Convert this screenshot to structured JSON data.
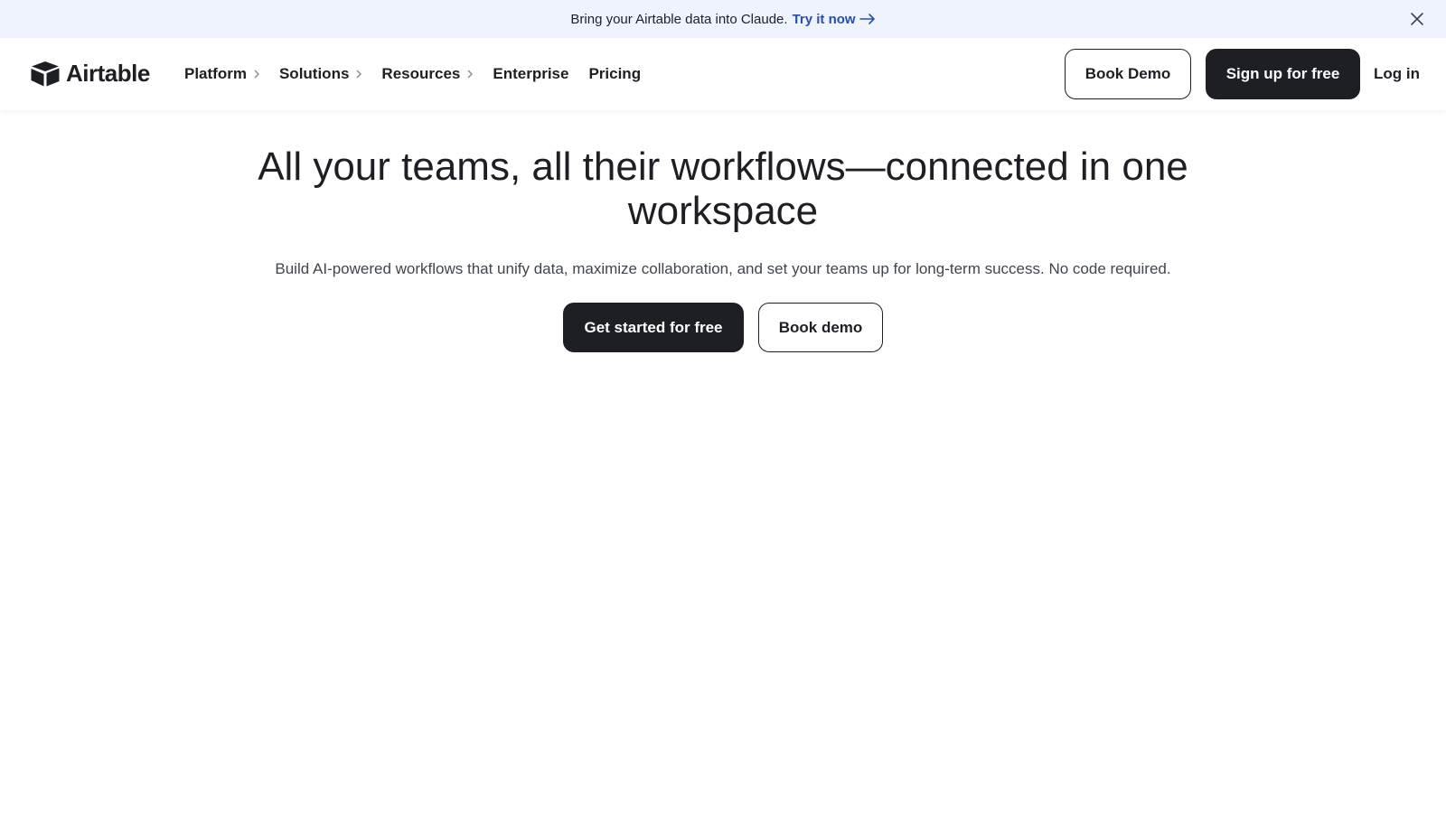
{
  "announcement": {
    "message": "Bring your Airtable data into Claude.",
    "cta": "Try it now",
    "icons": {
      "arrow": "arrow-right-icon",
      "close": "close-icon"
    },
    "background": "#eef3fd",
    "link_color": "#254fad"
  },
  "header": {
    "logo_text": "Airtable",
    "logo_icon": "airtable-logo-icon",
    "nav": [
      {
        "label": "Platform",
        "has_submenu": true
      },
      {
        "label": "Solutions",
        "has_submenu": true
      },
      {
        "label": "Resources",
        "has_submenu": true
      },
      {
        "label": "Enterprise",
        "has_submenu": false
      },
      {
        "label": "Pricing",
        "has_submenu": false
      }
    ],
    "book_demo": "Book Demo",
    "signup": "Sign up for free",
    "login": "Log in"
  },
  "hero": {
    "title": "All your teams, all their workflows—connected in one workspace",
    "subtitle": "Build AI-powered workflows that unify data, maximize collaboration, and set your teams up for long-term success. No code required.",
    "primary_cta": "Get started for free",
    "secondary_cta": "Book demo"
  },
  "colors": {
    "primary_button": "#1d1f25",
    "text": "#1d1f25"
  }
}
